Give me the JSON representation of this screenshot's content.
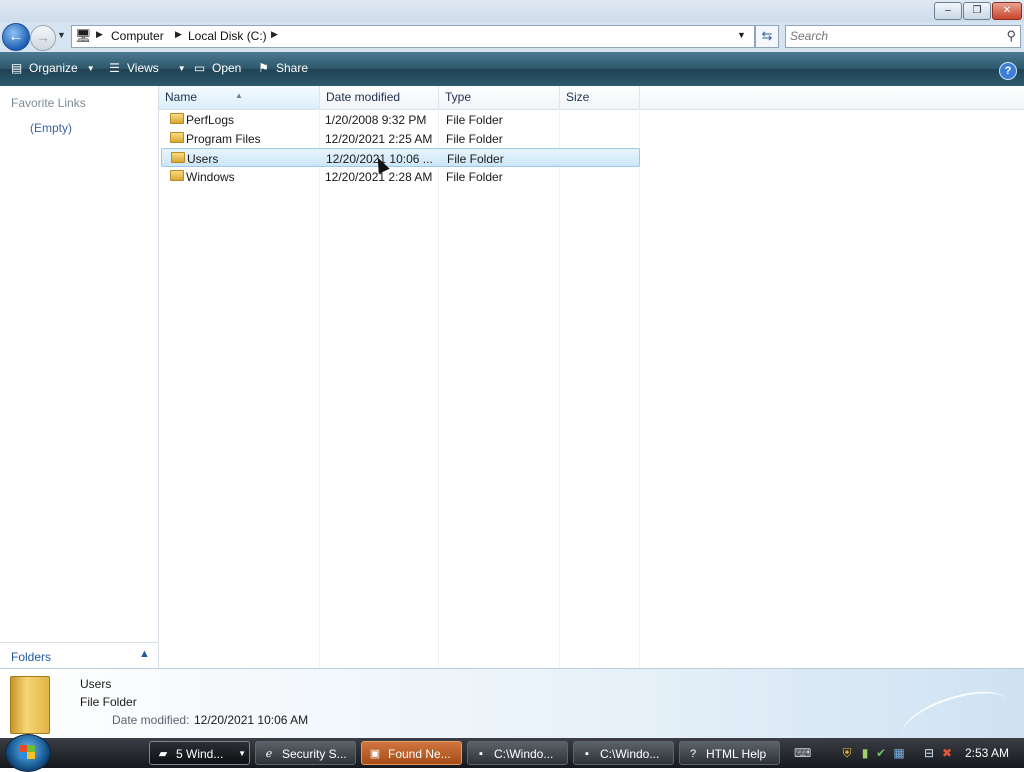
{
  "window": {
    "minimize_label": "–",
    "maximize_label": "❐",
    "close_label": "✕"
  },
  "address": {
    "crumbs": [
      "Computer",
      "Local Disk (C:)"
    ],
    "search_placeholder": "Search"
  },
  "toolbar": {
    "organize_label": "Organize",
    "views_label": "Views",
    "open_label": "Open",
    "share_label": "Share",
    "help_label": "?"
  },
  "nav": {
    "favorite_links_heading": "Favorite Links",
    "empty_label": "(Empty)",
    "folders_label": "Folders"
  },
  "columns": {
    "name": "Name",
    "date_modified": "Date modified",
    "type": "Type",
    "size": "Size"
  },
  "files": [
    {
      "name": "PerfLogs",
      "date": "1/20/2008 9:32 PM",
      "type": "File Folder"
    },
    {
      "name": "Program Files",
      "date": "12/20/2021 2:25 AM",
      "type": "File Folder"
    },
    {
      "name": "Users",
      "date": "12/20/2021 10:06 ...",
      "type": "File Folder"
    },
    {
      "name": "Windows",
      "date": "12/20/2021 2:28 AM",
      "type": "File Folder"
    }
  ],
  "selected_file_index": 2,
  "details": {
    "name": "Users",
    "type": "File Folder",
    "date_label": "Date modified:",
    "date_value": "12/20/2021 10:06 AM"
  },
  "taskbar": {
    "buttons": [
      {
        "label": "5 Wind...",
        "icon": "folder-icon"
      },
      {
        "label": "Security S...",
        "icon": "ie-icon"
      },
      {
        "label": "Found Ne...",
        "icon": "hardware-icon"
      },
      {
        "label": "C:\\Windo...",
        "icon": "cmd-icon"
      },
      {
        "label": "C:\\Windo...",
        "icon": "cmd-icon"
      },
      {
        "label": "HTML Help",
        "icon": "help-icon"
      }
    ],
    "clock": "2:53 AM"
  },
  "colors": {
    "command_bar": "#2c5669",
    "selection": "#cde6f8",
    "link_blue": "#1f5a9e"
  }
}
